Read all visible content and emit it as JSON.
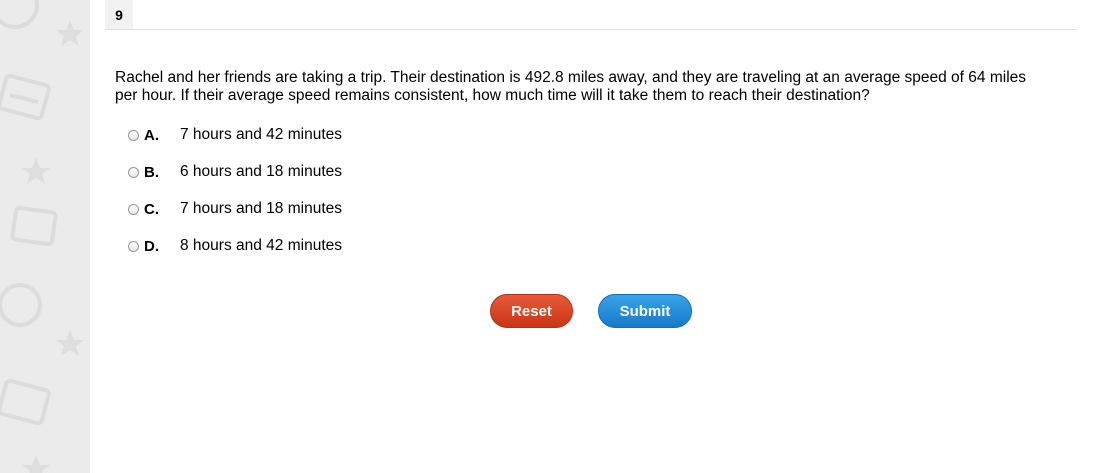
{
  "question": {
    "number": "9",
    "text": "Rachel and her friends are taking a trip. Their destination is 492.8 miles away, and they are traveling at an average speed of 64 miles per hour. If their average speed remains consistent, how much time will it take them to reach their destination?"
  },
  "choices": [
    {
      "letter": "A.",
      "text": "7 hours and 42 minutes"
    },
    {
      "letter": "B.",
      "text": "6 hours and 18 minutes"
    },
    {
      "letter": "C.",
      "text": "7 hours and 18 minutes"
    },
    {
      "letter": "D.",
      "text": "8 hours and 42 minutes"
    }
  ],
  "buttons": {
    "reset_label": "Reset",
    "submit_label": "Submit"
  },
  "colors": {
    "reset": "#d8411f",
    "submit": "#2a8fdc",
    "sidebar_bg": "#ebebeb"
  }
}
